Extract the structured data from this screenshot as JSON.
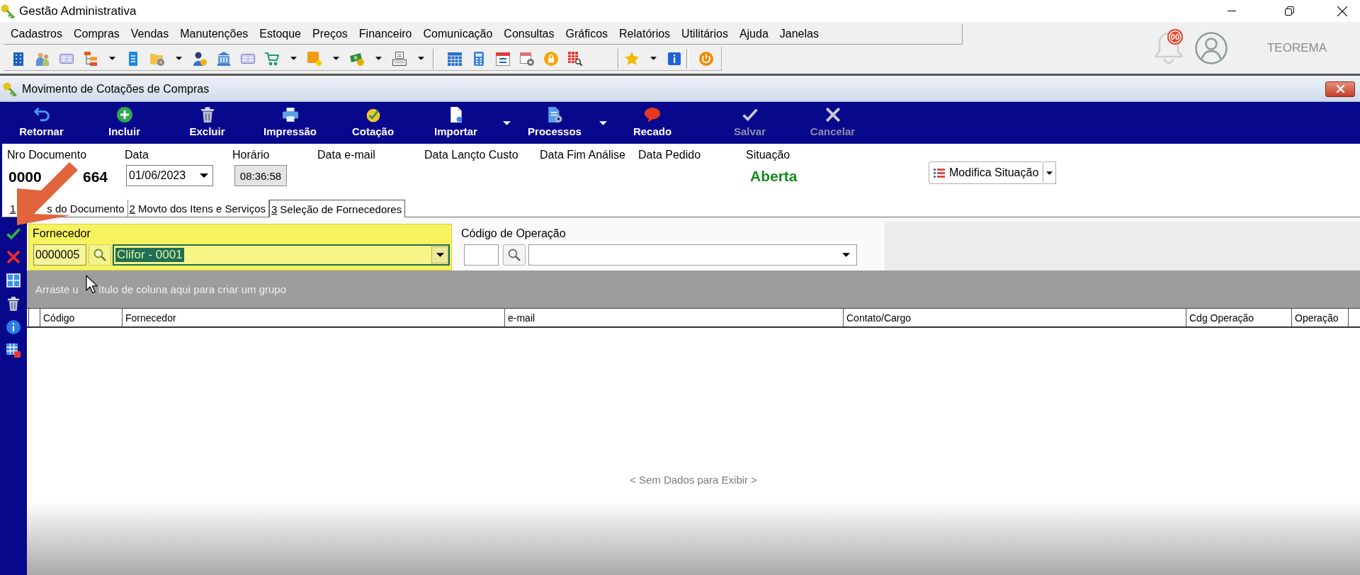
{
  "app": {
    "title": "Gestão Administrativa"
  },
  "menu": [
    {
      "label": "Cadastros"
    },
    {
      "label": "Compras"
    },
    {
      "label": "Vendas"
    },
    {
      "label": "Manutenções"
    },
    {
      "label": "Estoque"
    },
    {
      "label": "Preços"
    },
    {
      "label": "Financeiro"
    },
    {
      "label": "Comunicação"
    },
    {
      "label": "Consultas"
    },
    {
      "label": "Gráficos"
    },
    {
      "label": "Relatórios"
    },
    {
      "label": "Utilitários"
    },
    {
      "label": "Ajuda"
    },
    {
      "label": "Janelas"
    }
  ],
  "toolbar": [
    {
      "items": [
        {
          "dropdown": false
        },
        {
          "dropdown": false
        },
        {
          "dropdown": false
        },
        {
          "dropdown": true
        },
        {
          "dropdown": false
        },
        {
          "dropdown": true
        },
        {
          "dropdown": false
        },
        {
          "dropdown": false
        },
        {
          "dropdown": false
        },
        {
          "dropdown": true
        },
        {
          "dropdown": true
        },
        {
          "dropdown": true
        },
        {
          "dropdown": true
        }
      ]
    },
    {
      "items": [
        {
          "dropdown": false
        },
        {
          "dropdown": false
        },
        {
          "dropdown": false
        },
        {
          "dropdown": false
        },
        {
          "dropdown": false
        },
        {
          "dropdown": false
        }
      ]
    },
    {
      "items": [
        {
          "dropdown": true
        },
        {
          "dropdown": false
        }
      ]
    },
    {
      "items": [
        {
          "dropdown": false
        }
      ]
    }
  ],
  "notifications": {
    "badge": "00"
  },
  "user": {
    "name": "TEOREMA"
  },
  "window": {
    "title": "Movimento de Cotações de Compras"
  },
  "actions": [
    {
      "label": "Retornar",
      "disabled": false,
      "dropdown": false
    },
    {
      "label": "Incluir",
      "disabled": false,
      "dropdown": false
    },
    {
      "label": "Excluir",
      "disabled": false,
      "dropdown": false
    },
    {
      "label": "Impressão",
      "disabled": false,
      "dropdown": false
    },
    {
      "label": "Cotação",
      "disabled": false,
      "dropdown": false
    },
    {
      "label": "Importar",
      "disabled": false,
      "dropdown": true
    },
    {
      "label": "Processos",
      "disabled": false,
      "dropdown": true
    },
    {
      "label": "Recado",
      "disabled": false,
      "dropdown": false
    },
    {
      "label": "Salvar",
      "disabled": true,
      "dropdown": false
    },
    {
      "label": "Cancelar",
      "disabled": true,
      "dropdown": false
    }
  ],
  "header_fields": [
    {
      "label": "Nro Documento",
      "kind": "number",
      "visible_parts": [
        "0000",
        "664"
      ]
    },
    {
      "label": "Data",
      "kind": "date",
      "value": "01/06/2023"
    },
    {
      "label": "Horário",
      "kind": "readonly",
      "value": "08:36:58"
    },
    {
      "label": "Data e-mail",
      "kind": "empty"
    },
    {
      "label": "Data Lançto Custo",
      "kind": "empty"
    },
    {
      "label": "Data Fim Análise",
      "kind": "empty"
    },
    {
      "label": "Data Pedido",
      "kind": "empty"
    },
    {
      "label": "Situação",
      "kind": "status",
      "value": "Aberta"
    }
  ],
  "status_button": {
    "label": "Modifica Situação"
  },
  "tabs": [
    {
      "number": "1",
      "label": "s do Documento",
      "selected": false
    },
    {
      "number": "2",
      "label": "Movto dos Itens e Serviços",
      "selected": false
    },
    {
      "number": "3",
      "label": "Seleção de Fornecedores",
      "selected": true
    }
  ],
  "supplier_filter": {
    "label": "Fornecedor",
    "highlighted": true,
    "code": "0000005",
    "name": "Clifor - 0001",
    "name_selected": true
  },
  "operation_filter": {
    "label": "Código de Operação"
  },
  "grid": {
    "group_hint": [
      "Arraste u",
      "ítulo de coluna aqui para criar um grupo"
    ],
    "columns": [
      "Código",
      "Fornecedor",
      "e-mail",
      "Contato/Cargo",
      "Cdg Operação",
      "Operação"
    ],
    "empty_text": "< Sem Dados para Exibir >"
  }
}
